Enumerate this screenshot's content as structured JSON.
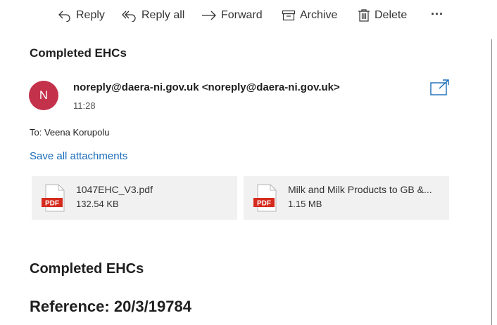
{
  "toolbar": {
    "reply": "Reply",
    "reply_all": "Reply all",
    "forward": "Forward",
    "archive": "Archive",
    "delete": "Delete",
    "more": "···"
  },
  "email": {
    "subject": "Completed EHCs",
    "avatar_initial": "N",
    "avatar_color": "#c4314b",
    "sender": "noreply@daera-ni.gov.uk <noreply@daera-ni.gov.uk>",
    "time": "11:28",
    "to_label": "To:",
    "to_name": "Veena Korupolu"
  },
  "attachments": {
    "save_all": "Save all attachments",
    "items": [
      {
        "icon": "PDF",
        "name": "1047EHC_V3.pdf",
        "size": "132.54 KB"
      },
      {
        "icon": "PDF",
        "name": "Milk and Milk Products to GB &...",
        "size": "1.15 MB"
      }
    ]
  },
  "body": {
    "heading": "Completed EHCs",
    "reference": "Reference: 20/3/19784"
  },
  "colors": {
    "link": "#1a6bb8",
    "pdf_red": "#d52b1e"
  }
}
